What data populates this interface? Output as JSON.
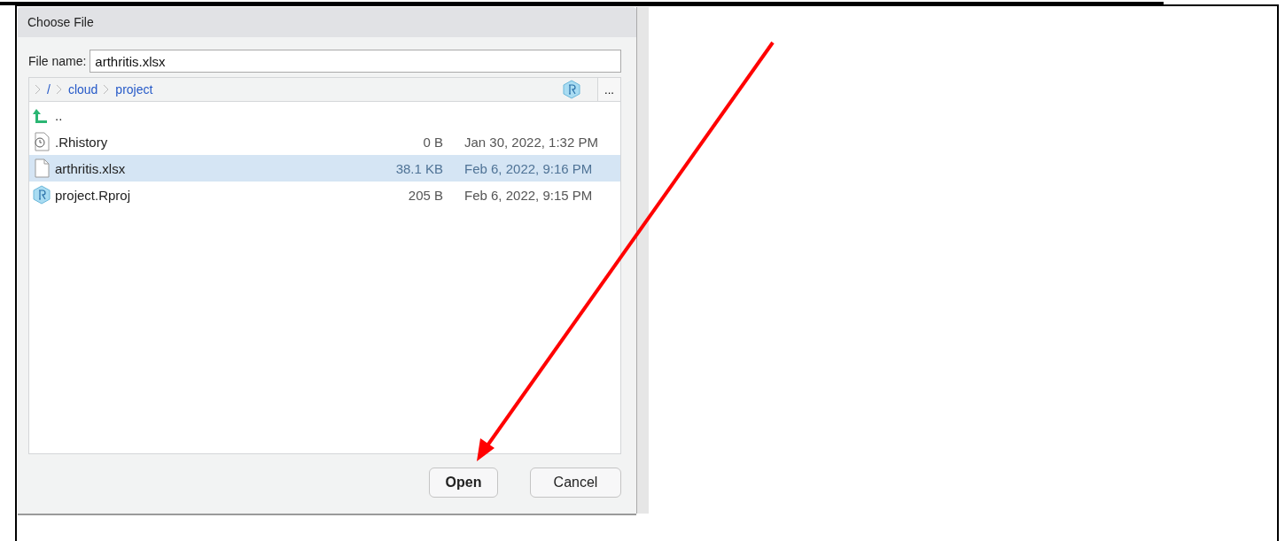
{
  "dialog": {
    "title": "Choose File",
    "file_name": {
      "label": "File name:",
      "value": "arthritis.xlsx"
    },
    "breadcrumb": [
      {
        "label": "/"
      },
      {
        "label": "cloud"
      },
      {
        "label": "project"
      }
    ],
    "more_button": "...",
    "files": [
      {
        "kind": "parent",
        "name": "..",
        "selected": false
      },
      {
        "kind": "history",
        "name": ".Rhistory",
        "size": "0 B",
        "date": "Jan 30, 2022, 1:32 PM",
        "selected": false
      },
      {
        "kind": "document",
        "name": "arthritis.xlsx",
        "size": "38.1 KB",
        "date": "Feb 6, 2022, 9:16 PM",
        "selected": true
      },
      {
        "kind": "rproj",
        "name": "project.Rproj",
        "size": "205 B",
        "date": "Feb 6, 2022, 9:15 PM",
        "selected": false
      }
    ],
    "buttons": [
      {
        "label": "Open"
      },
      {
        "label": "Cancel"
      }
    ]
  }
}
